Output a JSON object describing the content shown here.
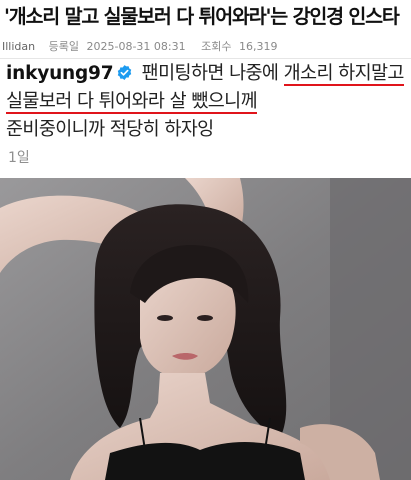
{
  "article": {
    "headline": "'개소리 말고 실물보러 다 튀어와라'는 강인경 인스타 ㄷㄷㄷ",
    "author": "Illidan",
    "date_label": "등록일",
    "date": "2025-08-31 08:31",
    "views_label": "조회수",
    "views": "16,319"
  },
  "post": {
    "username": "inkyung97",
    "caption_line1_a": " 팬미팅하면 나중에 ",
    "caption_line1_b": "개소리 하지말고",
    "caption_line2": "실물보러 다 튀어와라 살 뺐으니께",
    "caption_line3": "준비중이니까 적당히 하자잉",
    "timestamp": "1일",
    "verified_icon": "verified-badge-icon",
    "underline_color": "#e0141b",
    "verified_color": "#1d9bf0"
  }
}
